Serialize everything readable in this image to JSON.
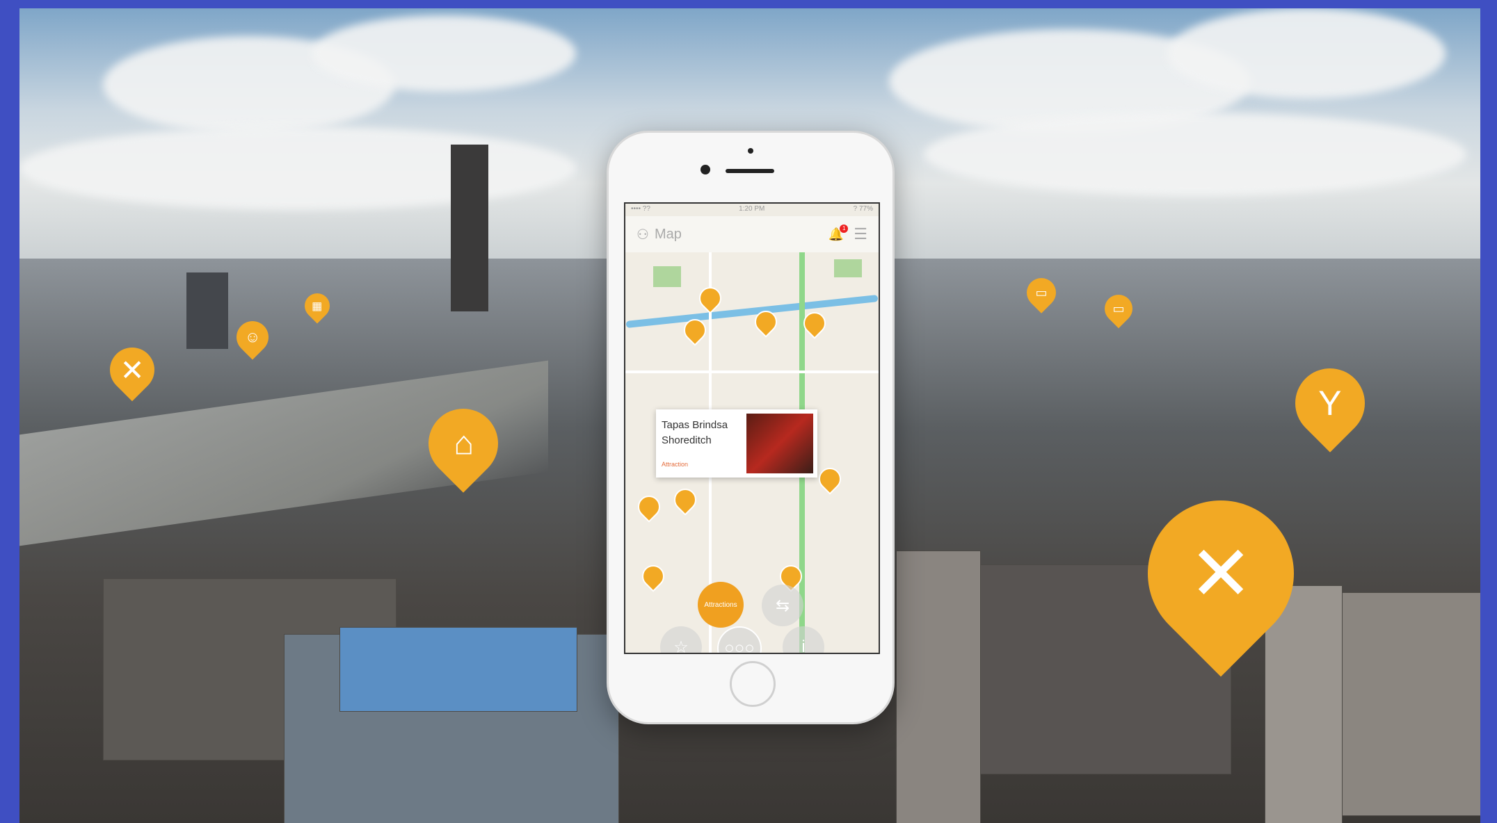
{
  "brand": {
    "accent": "#f2a924",
    "background": "#3f4fc2"
  },
  "phone": {
    "status": {
      "carrier": "•••• ?? ",
      "time": "1:20 PM",
      "battery": "? 77% "
    },
    "navbar": {
      "title": "Map",
      "notification_count": "1",
      "left_icon": "user-icon",
      "right_icon": "hamburger-icon"
    },
    "popup": {
      "title": "Tapas Brindsa Shoreditch",
      "category": "Attraction"
    },
    "fab_label": "Attractions",
    "toolbar": {
      "favorites_icon": "star-icon",
      "more_icon": "dots-icon",
      "info_icon": "info-icon"
    }
  },
  "scene_pins": [
    {
      "icon": "cutlery-icon"
    },
    {
      "icon": "smile-icon"
    },
    {
      "icon": "calendar-icon"
    },
    {
      "icon": "museum-icon"
    },
    {
      "icon": "bed-icon"
    },
    {
      "icon": "bed-icon"
    },
    {
      "icon": "cocktail-icon"
    },
    {
      "icon": "cutlery-icon"
    }
  ]
}
